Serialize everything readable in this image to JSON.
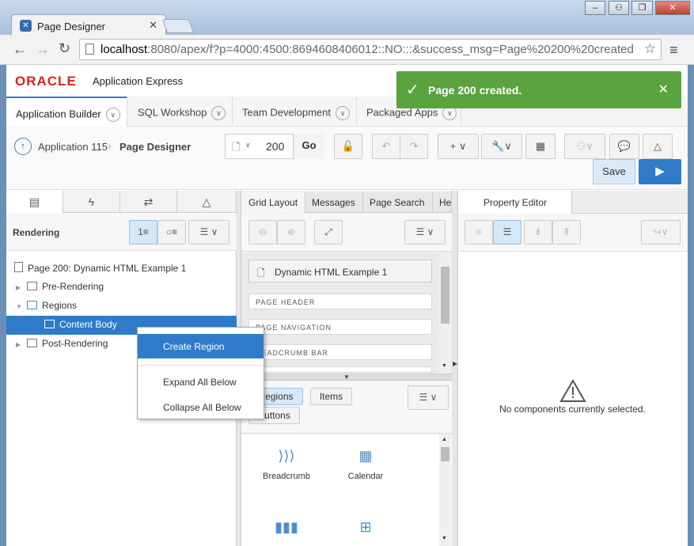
{
  "browser": {
    "tab_title": "Page Designer",
    "url_domain": "localhost",
    "url_rest": ":8080/apex/f?p=4000:4500:8694608406012::NO:::&success_msg=Page%20200%20created"
  },
  "header": {
    "logo": "ORACLE",
    "product": "Application Express"
  },
  "nav_tabs": [
    {
      "label": "Application Builder"
    },
    {
      "label": "SQL Workshop"
    },
    {
      "label": "Team Development"
    },
    {
      "label": "Packaged Apps"
    }
  ],
  "notification": {
    "message": "Page 200 created."
  },
  "toolbar": {
    "breadcrumb_app": "Application 115",
    "breadcrumb_page": "Page Designer",
    "page_number": "200",
    "go_label": "Go",
    "save_label": "Save"
  },
  "left_panel": {
    "title": "Rendering",
    "tree": [
      {
        "label": "Page 200: Dynamic HTML Example 1"
      },
      {
        "label": "Pre-Rendering"
      },
      {
        "label": "Regions"
      },
      {
        "label": "Content Body"
      },
      {
        "label": "Post-Rendering"
      }
    ]
  },
  "context_menu": {
    "items": [
      {
        "label": "Create Region"
      },
      {
        "label": "Expand All Below"
      },
      {
        "label": "Collapse All Below"
      }
    ]
  },
  "middle_panel": {
    "tabs": [
      {
        "label": "Grid Layout"
      },
      {
        "label": "Messages"
      },
      {
        "label": "Page Search"
      },
      {
        "label": "He"
      }
    ],
    "page_box": "Dynamic HTML Example 1",
    "slots": [
      "PAGE HEADER",
      "PAGE NAVIGATION",
      "READCRUMB BAR"
    ],
    "gallery_tabs": [
      "Regions",
      "Items",
      "Buttons"
    ],
    "gallery_items": [
      {
        "label": "Breadcrumb"
      },
      {
        "label": "Calendar"
      }
    ]
  },
  "right_panel": {
    "title": "Property Editor",
    "empty_message": "No components currently selected."
  }
}
